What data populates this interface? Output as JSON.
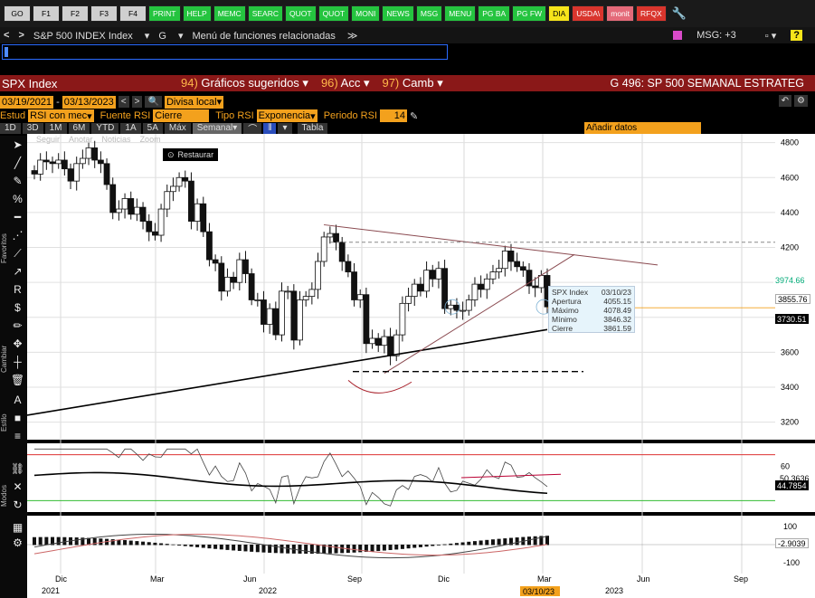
{
  "fkeys": [
    {
      "label": "GO",
      "style": "gray"
    },
    {
      "label": "F1",
      "style": "gray"
    },
    {
      "label": "F2",
      "style": "gray"
    },
    {
      "label": "F3",
      "style": "gray"
    },
    {
      "label": "F4",
      "style": "gray"
    },
    {
      "label": "PRINT",
      "style": "green"
    },
    {
      "label": "HELP",
      "style": "green"
    },
    {
      "label": "MEMC",
      "style": "green"
    },
    {
      "label": "SEARC",
      "style": "green"
    },
    {
      "label": "QUOT",
      "style": "green"
    },
    {
      "label": "QUOT",
      "style": "green"
    },
    {
      "label": "MONI",
      "style": "green"
    },
    {
      "label": "NEWS",
      "style": "green"
    },
    {
      "label": "MSG",
      "style": "green"
    },
    {
      "label": "MENU",
      "style": "green"
    },
    {
      "label": "PG BA",
      "style": "green"
    },
    {
      "label": "PG FW",
      "style": "green"
    },
    {
      "label": "DIA",
      "style": "yellow"
    },
    {
      "label": "USDA\\",
      "style": "red"
    },
    {
      "label": "monit",
      "style": "pink"
    },
    {
      "label": "RFQX",
      "style": "red"
    }
  ],
  "nav": {
    "back": "<",
    "forward": ">",
    "security": "S&P 500 INDEX Index",
    "menu_g": "G",
    "related": "Menú de funciones relacionadas",
    "msg": "MSG: +3",
    "help": "?"
  },
  "title": {
    "ticker": "SPX Index",
    "suggested": {
      "num": "94)",
      "label": "Gráficos sugeridos"
    },
    "actions": {
      "num": "96)",
      "label": "Acc"
    },
    "change": {
      "num": "97)",
      "label": "Camb"
    },
    "chart_name": "G 496: SP 500 SEMANAL ESTRATEG"
  },
  "dates": {
    "start": "03/19/2021",
    "sep": "-",
    "end": "03/13/2023",
    "currency": "Divisa local"
  },
  "study": {
    "estud_label": "Estud",
    "estud_value": "RSI con mec",
    "fuente_label": "Fuente RSI",
    "fuente_value": "Cierre",
    "tipo_label": "Tipo RSI",
    "tipo_value": "Exponencia",
    "periodo_label": "Periodo RSI",
    "periodo_value": "14"
  },
  "periods": [
    "1D",
    "3D",
    "1M",
    "6M",
    "YTD",
    "1A",
    "5A",
    "Máx"
  ],
  "freq": "Semanal",
  "table_btn": "Tabla",
  "add_data": "Añadir datos",
  "faded_tools": [
    "Seguir",
    "Anotar",
    "Noticias",
    "Zoom"
  ],
  "restore": "Restaurar",
  "side_labels": {
    "favoritos": "Favoritos",
    "cambiar": "Cambiar",
    "estilo": "Estilo",
    "modos": "Modos"
  },
  "tooltip": {
    "title": "SPX Index",
    "date": "03/10/23",
    "rows": [
      {
        "k": "Apertura",
        "v": "4055.15"
      },
      {
        "k": "Máximo",
        "v": "4078.49"
      },
      {
        "k": "Mínimo",
        "v": "3846.32"
      },
      {
        "k": "Cierre",
        "v": "3861.59"
      }
    ]
  },
  "price_axis": {
    "ticks": [
      "4800",
      "4600",
      "4400",
      "4200",
      "3600",
      "3400",
      "3200"
    ],
    "tag_a": "3974.66",
    "tag_b": "3855.76",
    "tag_c": "3730.51"
  },
  "rsi_axis": {
    "ticks": [
      "60"
    ],
    "tag_a": "50.3636",
    "tag_b": "44.7854"
  },
  "macd_axis": {
    "ticks": [
      "100",
      "-100"
    ],
    "tag": "-2.9039"
  },
  "xaxis": {
    "months": [
      "Dic",
      "Mar",
      "Jun",
      "Sep",
      "Dic",
      "Mar",
      "Jun",
      "Sep"
    ],
    "years": [
      "2021",
      "2022",
      "2023"
    ],
    "cursor_date": "03/10/23"
  },
  "chart_data": {
    "type": "candlestick",
    "title": "",
    "frequency": "weekly",
    "ylim": [
      3100,
      4850
    ],
    "yticks": [
      3200,
      3400,
      3600,
      3800,
      4000,
      4200,
      4400,
      4600,
      4800
    ],
    "closes": [
      4620,
      4700,
      4690,
      4680,
      4700,
      4650,
      4580,
      4680,
      4710,
      4770,
      4700,
      4680,
      4560,
      4400,
      4420,
      4480,
      4390,
      4430,
      4350,
      4290,
      4270,
      4420,
      4520,
      4550,
      4600,
      4580,
      4350,
      4450,
      4290,
      4130,
      4110,
      3950,
      4030,
      4000,
      4130,
      4050,
      3900,
      3900,
      3760,
      3850,
      3700,
      3950,
      3950,
      3670,
      3900,
      3920,
      3960,
      4120,
      4260,
      4280,
      4230,
      4120,
      4060,
      3900,
      3930,
      3650,
      3680,
      3640,
      3690,
      3580,
      3700,
      3880,
      3920,
      3990,
      3950,
      4070,
      4020,
      4080,
      3850,
      3870,
      3840,
      3840,
      3900,
      3990,
      3960,
      4020,
      4060,
      4080,
      4180,
      4120,
      4090,
      4070,
      3980,
      3970,
      4040,
      3860
    ],
    "moving_average": {
      "start": 3240,
      "end": 3730
    },
    "rsi": {
      "ylim": [
        20,
        80
      ],
      "upper": 70,
      "lower": 30,
      "last": 44.7854
    },
    "macd": {
      "ylim": [
        -160,
        160
      ],
      "last": -2.9039
    }
  }
}
